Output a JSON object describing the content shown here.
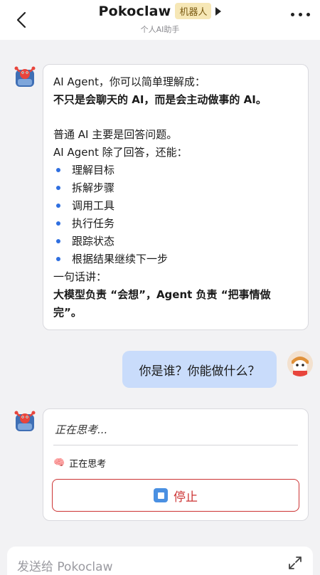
{
  "header": {
    "title": "Pokoclaw",
    "badge": "机器人",
    "subtitle": "个人AI助手"
  },
  "messages": {
    "bot1": {
      "lines": [
        {
          "text": "AI Agent，你可以简单理解成：",
          "bold": false
        },
        {
          "text": "不只是会聊天的 AI，而是会主动做事的 AI。",
          "bold": true
        },
        {
          "text": "普通 AI 主要是回答问题。",
          "bold": false
        },
        {
          "text": "AI Agent 除了回答，还能：",
          "bold": false
        }
      ],
      "bullets": [
        "理解目标",
        "拆解步骤",
        "调用工具",
        "执行任务",
        "跟踪状态",
        "根据结果继续下一步"
      ],
      "summary_intro": "一句话讲：",
      "summary_line1": "大模型负责 “会想”，Agent 负责 “把事情做",
      "summary_line2": "完”。"
    },
    "user1": {
      "text": "你是谁？你能做什么？"
    },
    "bot2": {
      "thinking_title": "正在思考...",
      "thinking_status": "正在思考",
      "thinking_emoji": "🧠",
      "stop_label": "停止"
    }
  },
  "composer": {
    "placeholder": "发送给 Pokoclaw"
  }
}
